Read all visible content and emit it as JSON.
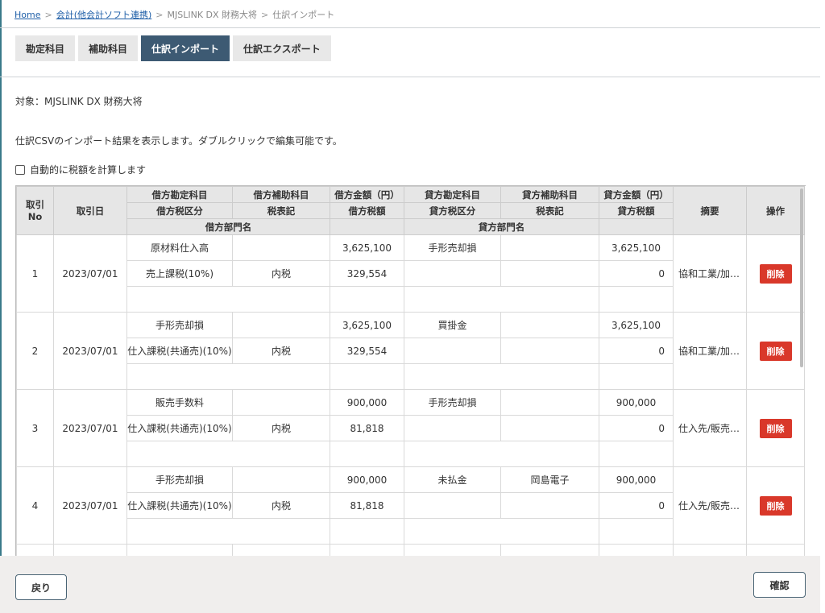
{
  "breadcrumb": {
    "home": "Home",
    "accounting": "会計(他会計ソフト連携)",
    "software": "MJSLINK DX 財務大将",
    "current": "仕訳インポート"
  },
  "tabs": [
    {
      "label": "勘定科目",
      "active": false
    },
    {
      "label": "補助科目",
      "active": false
    },
    {
      "label": "仕訳インポート",
      "active": true
    },
    {
      "label": "仕訳エクスポート",
      "active": false
    }
  ],
  "target_label": "対象：MJSLINK DX 財務大将",
  "description": "仕訳CSVのインポート結果を表示します。ダブルクリックで編集可能です。",
  "auto_tax": {
    "label": "自動的に税額を計算します",
    "checked": false
  },
  "headers": {
    "no": "取引\nNo",
    "date": "取引日",
    "debit_account": "借方勘定科目",
    "debit_sub": "借方補助科目",
    "debit_amount": "借方金額（円）",
    "credit_account": "貸方勘定科目",
    "credit_sub": "貸方補助科目",
    "credit_amount": "貸方金額（円）",
    "summary": "摘要",
    "operation": "操作",
    "debit_tax_class": "借方税区分",
    "tax_notation_1": "税表記",
    "debit_tax": "借方税額",
    "credit_tax_class": "貸方税区分",
    "tax_notation_2": "税表記",
    "credit_tax": "貸方税額",
    "debit_dept": "借方部門名",
    "credit_dept": "貸方部門名"
  },
  "delete_label": "削除",
  "rows": [
    {
      "no": "1",
      "date": "2023/07/01",
      "debit_account": "原材料仕入高",
      "debit_sub": "",
      "debit_amount": "3,625,100",
      "credit_account": "手形売却損",
      "credit_sub": "",
      "credit_amount": "3,625,100",
      "debit_tax_class": "売上課税(10%)",
      "tax_notation": "内税",
      "debit_tax": "329,554",
      "credit_tax_class": "",
      "credit_tax_notation": "",
      "credit_tax": "0",
      "summary": "協和工業/加…",
      "debit_dept": "",
      "credit_dept": ""
    },
    {
      "no": "2",
      "date": "2023/07/01",
      "debit_account": "手形売却損",
      "debit_sub": "",
      "debit_amount": "3,625,100",
      "credit_account": "買掛金",
      "credit_sub": "",
      "credit_amount": "3,625,100",
      "debit_tax_class": "仕入課税(共通売)(10%)",
      "tax_notation": "内税",
      "debit_tax": "329,554",
      "credit_tax_class": "",
      "credit_tax_notation": "",
      "credit_tax": "0",
      "summary": "協和工業/加…",
      "debit_dept": "",
      "credit_dept": ""
    },
    {
      "no": "3",
      "date": "2023/07/01",
      "debit_account": "販売手数料",
      "debit_sub": "",
      "debit_amount": "900,000",
      "credit_account": "手形売却損",
      "credit_sub": "",
      "credit_amount": "900,000",
      "debit_tax_class": "仕入課税(共通売)(10%)",
      "tax_notation": "内税",
      "debit_tax": "81,818",
      "credit_tax_class": "",
      "credit_tax_notation": "",
      "credit_tax": "0",
      "summary": "仕入先/販売…",
      "debit_dept": "",
      "credit_dept": ""
    },
    {
      "no": "4",
      "date": "2023/07/01",
      "debit_account": "手形売却損",
      "debit_sub": "",
      "debit_amount": "900,000",
      "credit_account": "未払金",
      "credit_sub": "岡島電子",
      "credit_amount": "900,000",
      "debit_tax_class": "仕入課税(共通売)(10%)",
      "tax_notation": "内税",
      "debit_tax": "81,818",
      "credit_tax_class": "",
      "credit_tax_notation": "",
      "credit_tax": "0",
      "summary": "仕入先/販売…",
      "debit_dept": "",
      "credit_dept": ""
    }
  ],
  "footer": {
    "back_label": "戻り",
    "confirm_label": "確認"
  }
}
